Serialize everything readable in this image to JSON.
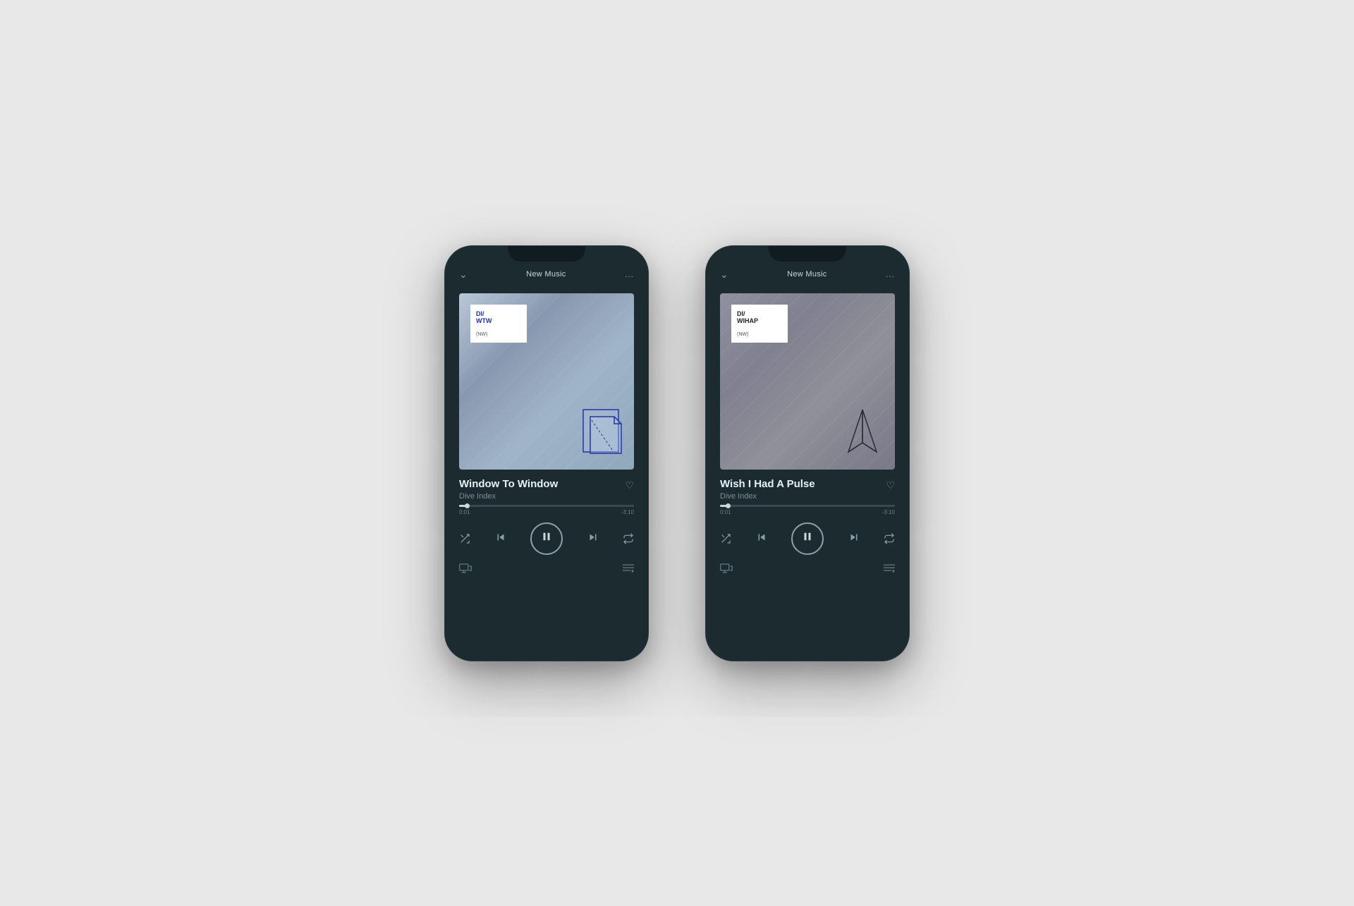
{
  "background": "#e8e8e8",
  "phones": [
    {
      "id": "phone-left",
      "header": {
        "back_icon": "chevron-down",
        "title": "New Music",
        "menu_icon": "..."
      },
      "album": {
        "art_type": "blue",
        "label_line1": "DI/",
        "label_line2": "WTW",
        "label_sub": "(NW)"
      },
      "song": {
        "title": "Window To Window",
        "artist": "Dive Index"
      },
      "progress": {
        "current_time": "0:01",
        "total_time": "-3:10",
        "fill_percent": 5
      },
      "controls": {
        "shuffle": "shuffle",
        "prev": "skip-prev",
        "play_pause": "pause",
        "next": "skip-next",
        "repeat": "repeat"
      }
    },
    {
      "id": "phone-right",
      "header": {
        "back_icon": "chevron-down",
        "title": "New Music",
        "menu_icon": "..."
      },
      "album": {
        "art_type": "gray",
        "label_line1": "DI/",
        "label_line2": "WIHAP",
        "label_sub": "(NW)"
      },
      "song": {
        "title": "Wish I Had A Pulse",
        "artist": "Dive Index"
      },
      "progress": {
        "current_time": "0:01",
        "total_time": "-3:10",
        "fill_percent": 5
      },
      "controls": {
        "shuffle": "shuffle",
        "prev": "skip-prev",
        "play_pause": "pause",
        "next": "skip-next",
        "repeat": "repeat"
      }
    }
  ]
}
